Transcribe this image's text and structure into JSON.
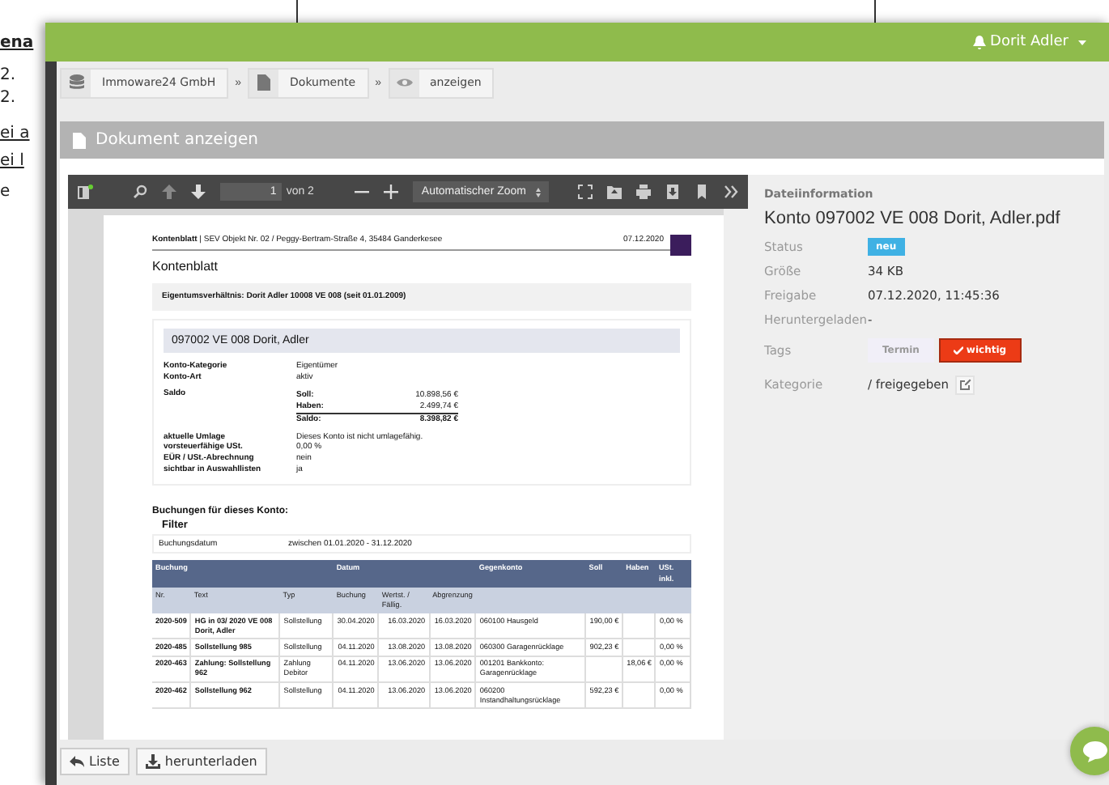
{
  "background_page": {
    "fragments": [
      "ena",
      "2.",
      "2.",
      "ei a",
      "ei l",
      "e"
    ]
  },
  "header": {
    "user": "Dorit Adler"
  },
  "breadcrumb": [
    {
      "label": "Immoware24 GmbH",
      "separator": "»"
    },
    {
      "label": "Dokumente",
      "separator": "»"
    },
    {
      "label": "anzeigen"
    }
  ],
  "panel": {
    "title": "Dokument anzeigen"
  },
  "pdf_viewer": {
    "page": "1",
    "page_count": "von 2",
    "zoom": "Automatischer Zoom",
    "document": {
      "header_title": "Kontenblatt",
      "header_text": "| SEV Objekt Nr. 02 / Peggy-Bertram-Straße 4, 35484 Ganderkesee",
      "date": "07.12.2020",
      "title": "Kontenblatt",
      "ownership": "Eigentumsverhältnis: Dorit Adler 10008 VE 008 (seit 01.01.2009)",
      "account_title": "097002 VE 008 Dorit, Adler",
      "fields": [
        {
          "label": "Konto-Kategorie",
          "value": "Eigentümer"
        },
        {
          "label": "Konto-Art",
          "value": "aktiv"
        }
      ],
      "saldo_label": "Saldo",
      "saldo": [
        {
          "label": "Soll:",
          "value": "10.898,56 €"
        },
        {
          "label": "Haben:",
          "value": "2.499,74 €"
        },
        {
          "label": "Saldo:",
          "value": "8.398,82 €"
        }
      ],
      "more_fields": [
        {
          "label": "aktuelle Umlage",
          "value": "Dieses Konto ist nicht umlagefähig."
        },
        {
          "label": "vorsteuerfähige USt.",
          "value": "0,00 %"
        },
        {
          "label": "EÜR / USt.-Abrechnung",
          "value": "nein"
        },
        {
          "label": "sichtbar in Auswahllisten",
          "value": "ja"
        }
      ],
      "bookings_title": "Buchungen für dieses Konto:",
      "filter_title": "Filter",
      "filter_label": "Buchungsdatum",
      "filter_value": "zwischen 01.01.2020 - 31.12.2020",
      "table": {
        "groups": [
          "Buchung",
          "Datum",
          "Gegenkonto",
          "Soll",
          "Haben",
          "USt. inkl."
        ],
        "columns": [
          "Nr.",
          "Text",
          "Typ",
          "Buchung",
          "Wertst. / Fällig.",
          "Abgrenzung"
        ],
        "rows": [
          [
            "2020-509",
            "HG in 03/ 2020 VE 008 Dorit, Adler",
            "Sollstellung",
            "30.04.2020",
            "16.03.2020",
            "16.03.2020",
            "060100 Hausgeld",
            "190,00 €",
            "",
            "0,00 %"
          ],
          [
            "2020-485",
            "Sollstellung 985",
            "Sollstellung",
            "04.11.2020",
            "13.08.2020",
            "13.08.2020",
            "060300 Garagenrücklage",
            "902,23 €",
            "",
            "0,00 %"
          ],
          [
            "2020-463",
            "Zahlung: Sollstellung 962",
            "Zahlung Debitor",
            "04.11.2020",
            "13.06.2020",
            "13.06.2020",
            "001201 Bankkonto: Garagenrücklage",
            "",
            "18,06 €",
            "0,00 %"
          ],
          [
            "2020-462",
            "Sollstellung 962",
            "Sollstellung",
            "04.11.2020",
            "13.06.2020",
            "13.06.2020",
            "060200 Instandhaltungsrücklage",
            "592,23 €",
            "",
            "0,00 %"
          ]
        ]
      }
    }
  },
  "file_info": {
    "heading": "Dateiinformation",
    "filename": "Konto 097002 VE 008 Dorit, Adler.pdf",
    "rows": [
      {
        "kind": "badge",
        "label": "Status",
        "value": "neu"
      },
      {
        "kind": "text",
        "label": "Größe",
        "value": "34 KB"
      },
      {
        "kind": "text",
        "label": "Freigabe",
        "value": "07.12.2020, 11:45:36"
      },
      {
        "kind": "text",
        "label": "Heruntergeladen",
        "value": "-"
      },
      {
        "kind": "tags",
        "label": "Tags",
        "tags": [
          {
            "label": "Termin",
            "selected": false
          },
          {
            "label": "wichtig",
            "selected": true
          }
        ]
      },
      {
        "kind": "category",
        "label": "Kategorie",
        "value": "/ freigegeben"
      }
    ]
  },
  "actions": [
    "Liste",
    "herunterladen"
  ]
}
